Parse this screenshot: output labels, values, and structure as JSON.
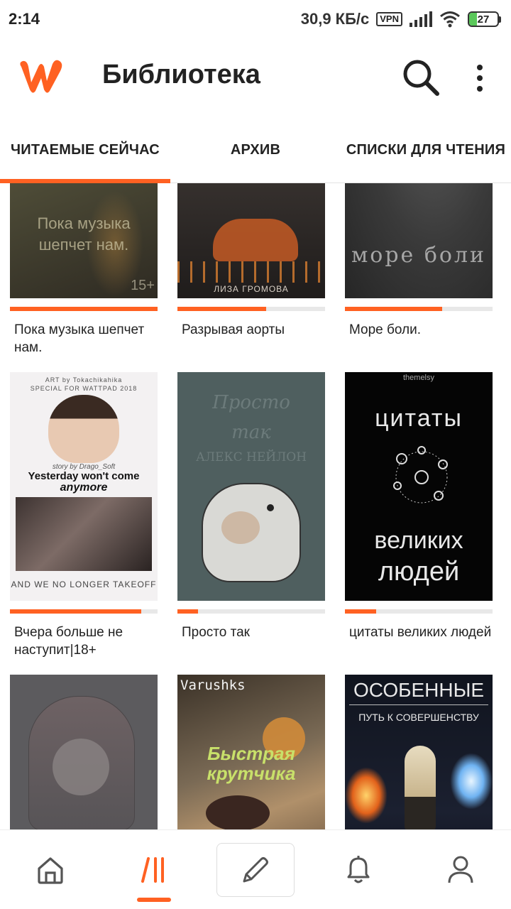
{
  "status_bar": {
    "time": "2:14",
    "speed": "30,9 КБ/с",
    "vpn": "VPN",
    "battery": "27",
    "battery_level": 0.27
  },
  "app_bar": {
    "title": "Библиотека",
    "search_icon": "search-icon",
    "menu_icon": "more-vertical-icon"
  },
  "tabs": [
    {
      "label": "ЧИТАЕМЫЕ СЕЙЧАС",
      "active": true
    },
    {
      "label": "АРХИВ",
      "active": false
    },
    {
      "label": "СПИСКИ ДЛЯ ЧТЕНИЯ",
      "active": false
    }
  ],
  "books": [
    {
      "title": "Пока музыка шепчет нам.",
      "progress": 1.0,
      "cover_text": [
        "Пока музыка",
        "шепчет нам."
      ],
      "cover_badge": "15+"
    },
    {
      "title": "Разрывая аорты",
      "progress": 0.6,
      "cover_text": [
        "ЛИЗА ГРОМОВА"
      ]
    },
    {
      "title": "Море боли.",
      "progress": 0.66,
      "cover_text": [
        "море боли"
      ]
    },
    {
      "title": "Вчера больше не наступит|18+",
      "progress": 0.89,
      "cover_text": [
        "ART by Tokachikahika",
        "SPECIAL FOR WATTPAD 2018",
        "story by Drago_Soft",
        "Yesterday won't come",
        "anymore",
        "AND WE NO LONGER TAKEOFF"
      ]
    },
    {
      "title": "Просто так",
      "progress": 0.14,
      "cover_text": [
        "Просто",
        "так",
        "АЛЕКС НЕЙЛОН"
      ]
    },
    {
      "title": "цитаты великих людей",
      "progress": 0.21,
      "cover_text": [
        "themelsy",
        "цитаты",
        "великих",
        "людей"
      ]
    },
    {
      "title": "",
      "progress": null,
      "cover_text": []
    },
    {
      "title": "",
      "progress": null,
      "cover_text": [
        "Varushks",
        "Быстрая",
        "крутчика"
      ]
    },
    {
      "title": "",
      "progress": null,
      "cover_text": [
        "ОСОБЕННЫЕ",
        "ПУТЬ К СОВЕРШЕНСТВУ"
      ]
    }
  ],
  "bottom_nav": [
    {
      "name": "home-icon",
      "active": false
    },
    {
      "name": "library-icon",
      "active": true
    },
    {
      "name": "pencil-icon",
      "active": false
    },
    {
      "name": "bell-icon",
      "active": false
    },
    {
      "name": "profile-icon",
      "active": false
    }
  ],
  "colors": {
    "accent": "#ff6122",
    "progress_track": "#e8e8e8"
  }
}
